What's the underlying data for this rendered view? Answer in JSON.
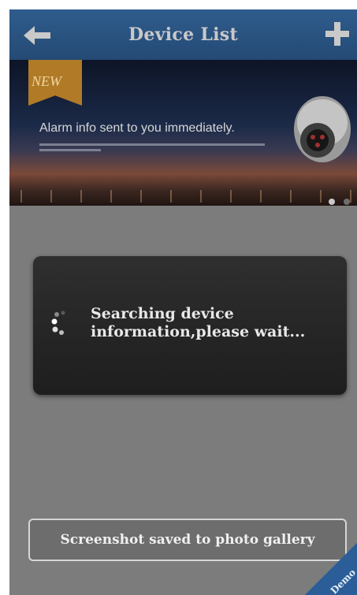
{
  "header": {
    "title": "Device List",
    "back_icon": "arrow-left-icon",
    "add_icon": "plus-icon"
  },
  "banner": {
    "ribbon_label": "NEW",
    "headline": "Alarm info sent to you immediately.",
    "carousel": {
      "pages": 2,
      "active_page": 1
    },
    "image_icon": "security-camera-icon"
  },
  "dialog": {
    "message": "Searching device information,please wait...",
    "spinner_icon": "loading-spinner-icon"
  },
  "toast": {
    "message": "Screenshot saved to photo gallery"
  },
  "corner_badge": {
    "label": "Demo",
    "color": "#2b5e98"
  },
  "colors": {
    "header_bg": "#2f5c8d",
    "overlay_bg": "#7c7c7c",
    "dialog_bg": "#1e1e1e",
    "ribbon": "#b07a27"
  }
}
